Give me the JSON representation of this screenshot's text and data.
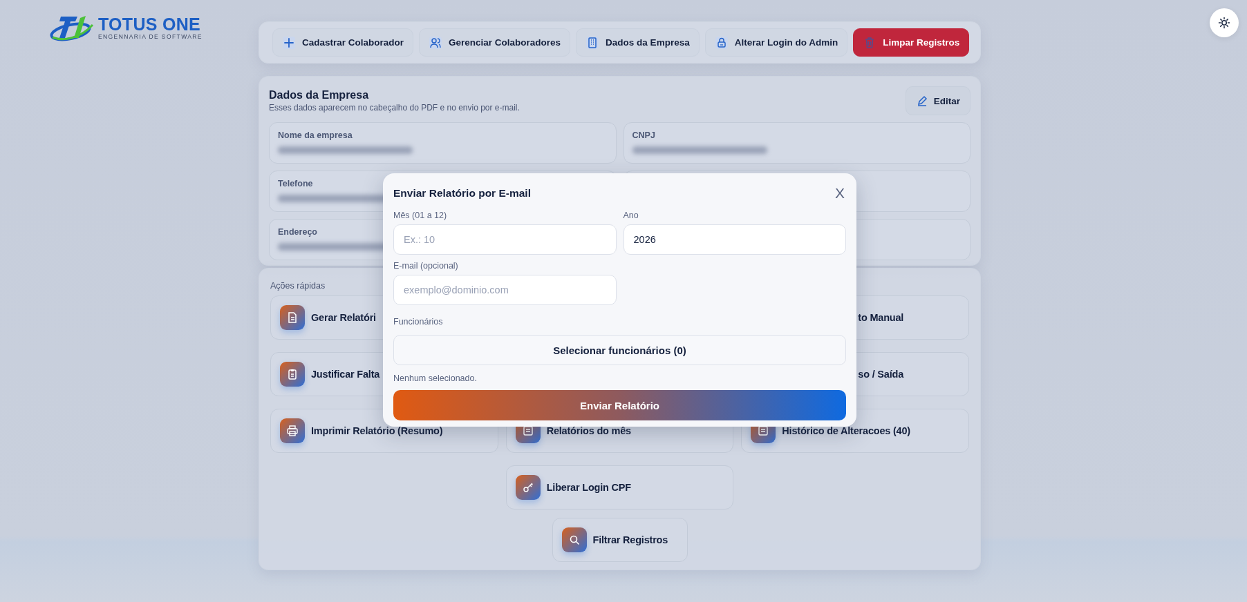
{
  "logo": {
    "name": "TOTUS ONE",
    "tagline": "ENGENNARIA DE SOFTWARE"
  },
  "nav": [
    {
      "label": "Cadastrar Colaborador",
      "kind": "normal"
    },
    {
      "label": "Gerenciar Colaboradores",
      "kind": "normal"
    },
    {
      "label": "Dados da Empresa",
      "kind": "normal"
    },
    {
      "label": "Alterar Login do Admin",
      "kind": "normal"
    },
    {
      "label": "Limpar Registros",
      "kind": "danger"
    }
  ],
  "company": {
    "title": "Dados da Empresa",
    "subtitle": "Esses dados aparecem no cabeçalho do PDF e no envio por e-mail.",
    "edit_button": "Editar",
    "fields": [
      {
        "kind": "field",
        "label": "Nome da empresa",
        "blurred": true
      },
      {
        "kind": "field",
        "label": "CNPJ",
        "blurred": true
      },
      {
        "kind": "field",
        "label": "Telefone",
        "blurred": true
      },
      {
        "kind": "covered"
      },
      {
        "kind": "field",
        "label": "Endereço",
        "blurred": true
      },
      {
        "kind": "covered"
      }
    ]
  },
  "quick_actions": {
    "title": "Ações rápidas",
    "rows": [
      {
        "left": {
          "label": "Gerar Relatóri"
        },
        "right": {
          "label": "to Manual",
          "covered_left": true
        }
      },
      {
        "left": {
          "label": "Justificar Falta"
        },
        "right": {
          "label": "so / Saída",
          "covered_left": true
        }
      },
      {
        "left": {
          "label": "Imprimir Relatório (Resumo)"
        },
        "middle": {
          "label": "Relatórios do mês"
        },
        "right": {
          "label": "Histórico de Alteracoes (40)"
        }
      },
      {
        "middle": {
          "label": "Liberar Login CPF"
        }
      }
    ],
    "footer_action": {
      "label": "Filtrar Registros"
    }
  },
  "modal": {
    "title": "Enviar Relatório por E-mail",
    "close": "X",
    "month": {
      "label": "Mês (01 a 12)",
      "placeholder": "Ex.: 10"
    },
    "year": {
      "label": "Ano",
      "value": "2026"
    },
    "email": {
      "label": "E-mail (opcional)",
      "placeholder": "exemplo@dominio.com"
    },
    "employees_label": "Funcionários",
    "select_button": "Selecionar funcionários (0)",
    "selection_status": "Nenhum selecionado.",
    "send_button": "Enviar Relatório"
  }
}
